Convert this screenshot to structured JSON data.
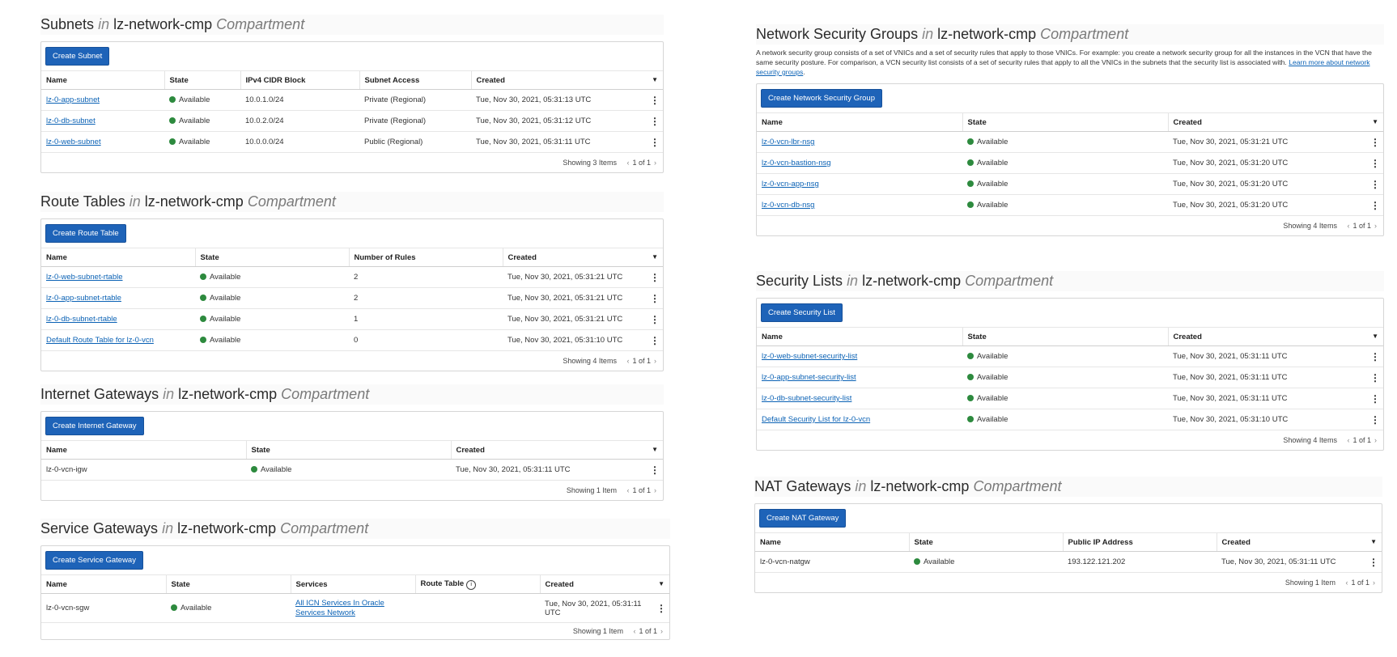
{
  "common": {
    "in_word": "in",
    "compartment_name": "lz-network-cmp",
    "compartment_word": "Compartment",
    "status_available": "Available",
    "page_text": "1 of 1",
    "prev_icon": "chevron-left-icon",
    "next_icon": "chevron-right-icon",
    "kebab_icon": "kebab-menu-icon",
    "sort_icon": "sort-down-icon",
    "status_color": "#2d8a3e",
    "accent_color": "#1e63b8"
  },
  "subnets": {
    "title": "Subnets",
    "button": "Create Subnet",
    "columns": [
      "Name",
      "State",
      "IPv4 CIDR Block",
      "Subnet Access",
      "Created"
    ],
    "rows": [
      {
        "name": "lz-0-app-subnet",
        "state": "Available",
        "cidr": "10.0.1.0/24",
        "access": "Private (Regional)",
        "created": "Tue, Nov 30, 2021, 05:31:13 UTC"
      },
      {
        "name": "lz-0-db-subnet",
        "state": "Available",
        "cidr": "10.0.2.0/24",
        "access": "Private (Regional)",
        "created": "Tue, Nov 30, 2021, 05:31:12 UTC"
      },
      {
        "name": "lz-0-web-subnet",
        "state": "Available",
        "cidr": "10.0.0.0/24",
        "access": "Public (Regional)",
        "created": "Tue, Nov 30, 2021, 05:31:11 UTC"
      }
    ],
    "footer": "Showing 3 Items"
  },
  "route_tables": {
    "title": "Route Tables",
    "button": "Create Route Table",
    "columns": [
      "Name",
      "State",
      "Number of Rules",
      "Created"
    ],
    "rows": [
      {
        "name": "lz-0-web-subnet-rtable",
        "state": "Available",
        "rules": "2",
        "created": "Tue, Nov 30, 2021, 05:31:21 UTC"
      },
      {
        "name": "lz-0-app-subnet-rtable",
        "state": "Available",
        "rules": "2",
        "created": "Tue, Nov 30, 2021, 05:31:21 UTC"
      },
      {
        "name": "lz-0-db-subnet-rtable",
        "state": "Available",
        "rules": "1",
        "created": "Tue, Nov 30, 2021, 05:31:21 UTC"
      },
      {
        "name": "Default Route Table for lz-0-vcn",
        "state": "Available",
        "rules": "0",
        "created": "Tue, Nov 30, 2021, 05:31:10 UTC"
      }
    ],
    "footer": "Showing 4 Items"
  },
  "internet_gateways": {
    "title": "Internet Gateways",
    "button": "Create Internet Gateway",
    "columns": [
      "Name",
      "State",
      "Created"
    ],
    "rows": [
      {
        "name": "lz-0-vcn-igw",
        "state": "Available",
        "created": "Tue, Nov 30, 2021, 05:31:11 UTC"
      }
    ],
    "footer": "Showing 1 Item"
  },
  "service_gateways": {
    "title": "Service Gateways",
    "button": "Create Service Gateway",
    "columns": [
      "Name",
      "State",
      "Services",
      "Route Table",
      "Created"
    ],
    "route_table_info_icon": "info-icon",
    "rows": [
      {
        "name": "lz-0-vcn-sgw",
        "state": "Available",
        "services": "All ICN Services In Oracle Services Network",
        "route_table": "",
        "created": "Tue, Nov 30, 2021, 05:31:11 UTC"
      }
    ],
    "footer": "Showing 1 Item"
  },
  "nsgs": {
    "title": "Network Security Groups",
    "description": "A network security group consists of a set of VNICs and a set of security rules that apply to those VNICs. For example: you create a network security group for all the instances in the VCN that have the same security posture. For comparison, a VCN security list consists of a set of security rules that apply to all the VNICs in the subnets that the security list is associated with.",
    "learn_more": "Learn more about network security groups",
    "button": "Create Network Security Group",
    "columns": [
      "Name",
      "State",
      "Created"
    ],
    "rows": [
      {
        "name": "lz-0-vcn-lbr-nsg",
        "state": "Available",
        "created": "Tue, Nov 30, 2021, 05:31:21 UTC"
      },
      {
        "name": "lz-0-vcn-bastion-nsg",
        "state": "Available",
        "created": "Tue, Nov 30, 2021, 05:31:20 UTC"
      },
      {
        "name": "lz-0-vcn-app-nsg",
        "state": "Available",
        "created": "Tue, Nov 30, 2021, 05:31:20 UTC"
      },
      {
        "name": "lz-0-vcn-db-nsg",
        "state": "Available",
        "created": "Tue, Nov 30, 2021, 05:31:20 UTC"
      }
    ],
    "footer": "Showing 4 Items"
  },
  "security_lists": {
    "title": "Security Lists",
    "button": "Create Security List",
    "columns": [
      "Name",
      "State",
      "Created"
    ],
    "rows": [
      {
        "name": "lz-0-web-subnet-security-list",
        "state": "Available",
        "created": "Tue, Nov 30, 2021, 05:31:11 UTC"
      },
      {
        "name": "lz-0-app-subnet-security-list",
        "state": "Available",
        "created": "Tue, Nov 30, 2021, 05:31:11 UTC"
      },
      {
        "name": "lz-0-db-subnet-security-list",
        "state": "Available",
        "created": "Tue, Nov 30, 2021, 05:31:11 UTC"
      },
      {
        "name": "Default Security List for lz-0-vcn",
        "state": "Available",
        "created": "Tue, Nov 30, 2021, 05:31:10 UTC"
      }
    ],
    "footer": "Showing 4 Items"
  },
  "nat_gateways": {
    "title": "NAT Gateways",
    "button": "Create NAT Gateway",
    "columns": [
      "Name",
      "State",
      "Public IP Address",
      "Created"
    ],
    "rows": [
      {
        "name": "lz-0-vcn-natgw",
        "state": "Available",
        "ip": "193.122.121.202",
        "created": "Tue, Nov 30, 2021, 05:31:11 UTC"
      }
    ],
    "footer": "Showing 1 Item"
  }
}
